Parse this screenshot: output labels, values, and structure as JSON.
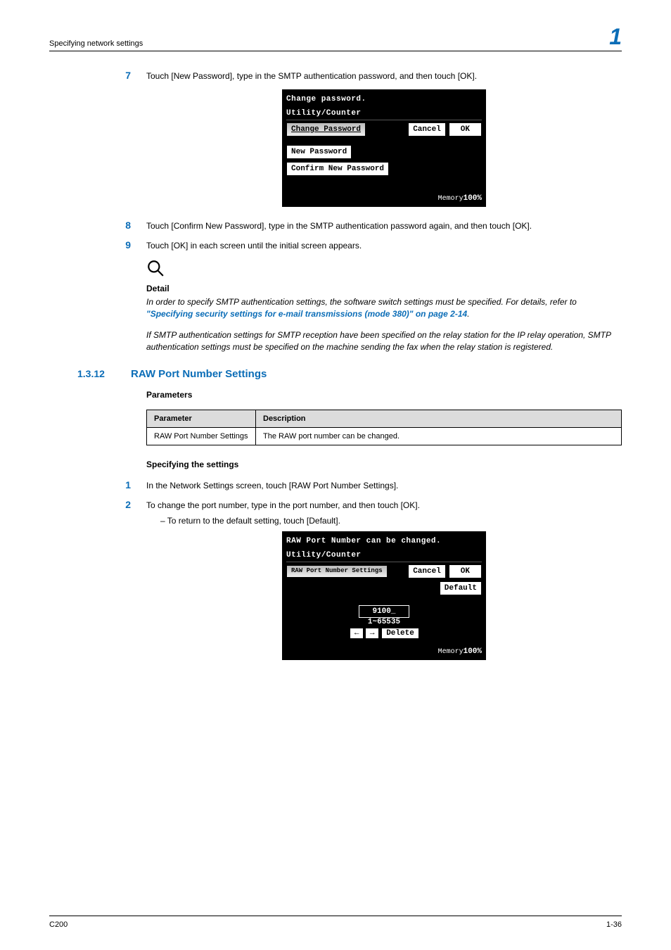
{
  "header": {
    "title": "Specifying network settings",
    "chapter_number": "1"
  },
  "steps": [
    {
      "num": "7",
      "text": "Touch [New Password], type in the SMTP authentication password, and then touch [OK]."
    },
    {
      "num": "8",
      "text": "Touch [Confirm New Password], type in the SMTP authentication password again, and then touch [OK]."
    },
    {
      "num": "9",
      "text": "Touch [OK] in each screen until the initial screen appears."
    }
  ],
  "lcd1": {
    "line1": "Change password.",
    "line2": "Utility/Counter",
    "main_label": "Change Password",
    "cancel": "Cancel",
    "ok": "OK",
    "btn_new": "New Password",
    "btn_confirm": "Confirm New Password",
    "memory_label": "Memory",
    "memory_value": "100%"
  },
  "detail": {
    "heading": "Detail",
    "p1_a": "In order to specify SMTP authentication settings, the software switch settings must be specified. For details, refer to ",
    "p1_link": "\"Specifying security settings for e-mail transmissions (mode 380)\" on page 2-14",
    "p1_b": ".",
    "p2": "If SMTP authentication settings for SMTP reception have been specified on the relay station for the IP relay operation, SMTP authentication settings must be specified on the machine sending the fax when the relay station is registered."
  },
  "section": {
    "num": "1.3.12",
    "title": "RAW Port Number Settings"
  },
  "params": {
    "heading": "Parameters",
    "th_param": "Parameter",
    "th_desc": "Description",
    "row_param": "RAW Port Number Settings",
    "row_desc": "The RAW port number can be changed."
  },
  "spec": {
    "heading": "Specifying the settings",
    "s1_num": "1",
    "s1_text": "In the Network Settings screen, touch [RAW Port Number Settings].",
    "s2_num": "2",
    "s2_text": "To change the port number, type in the port number, and then touch [OK].",
    "bullet": "–   To return to the default setting, touch [Default]."
  },
  "lcd2": {
    "line1": "RAW Port Number can be changed.",
    "line2": "Utility/Counter",
    "main_label": "RAW Port Number Settings",
    "cancel": "Cancel",
    "ok": "OK",
    "default": "Default",
    "port": "9100_",
    "range": "1~65535",
    "delete": "Delete",
    "memory_label": "Memory",
    "memory_value": "100%"
  },
  "footer": {
    "left": "C200",
    "right": "1-36"
  }
}
